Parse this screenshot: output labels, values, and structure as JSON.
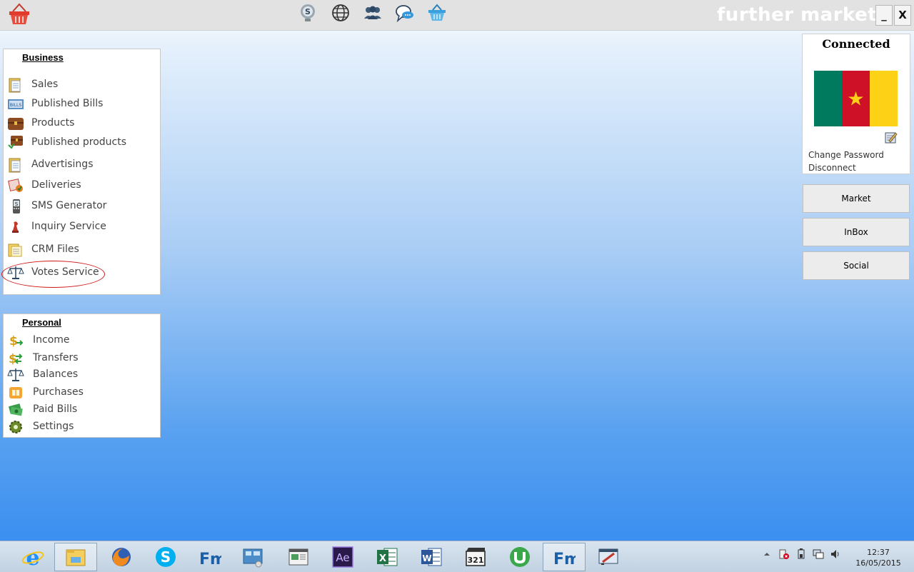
{
  "app": {
    "brand": "further market"
  },
  "window_controls": {
    "minimize": "_",
    "close": "X"
  },
  "top_icons": [
    "skype-bulb-icon",
    "globe-icon",
    "users-icon",
    "chat-icon",
    "basket-icon"
  ],
  "business": {
    "title": "Business",
    "items": [
      {
        "label": "Sales",
        "icon": "clipboard-icon"
      },
      {
        "label": "Published Bills",
        "icon": "bills-icon"
      },
      {
        "label": "Products",
        "icon": "chest-icon"
      },
      {
        "label": "Published products",
        "icon": "chest-publish-icon"
      },
      {
        "label": "Advertisings",
        "icon": "clipboard-icon"
      },
      {
        "label": "Deliveries",
        "icon": "delivery-icon"
      },
      {
        "label": "SMS Generator",
        "icon": "phone-icon"
      },
      {
        "label": "Inquiry Service",
        "icon": "chess-icon"
      },
      {
        "label": "CRM Files",
        "icon": "files-icon"
      },
      {
        "label": "Votes Service",
        "icon": "scales-icon"
      }
    ]
  },
  "personal": {
    "title": "Personal",
    "items": [
      {
        "label": "Income",
        "icon": "dollar-in-icon"
      },
      {
        "label": "Transfers",
        "icon": "dollar-transfer-icon"
      },
      {
        "label": "Balances",
        "icon": "scales-icon"
      },
      {
        "label": "Purchases",
        "icon": "cart-icon"
      },
      {
        "label": "Paid Bills",
        "icon": "money-icon"
      },
      {
        "label": "Settings",
        "icon": "gear-icon"
      }
    ]
  },
  "connection": {
    "status": "Connected",
    "flag": {
      "colors": [
        "#007a5e",
        "#ce1126",
        "#fcd116"
      ],
      "star": "#fcd116"
    },
    "change_password": "Change Password",
    "disconnect": "Disconnect"
  },
  "side_buttons": {
    "market": "Market",
    "inbox": "InBox",
    "social": "Social"
  },
  "taskbar": {
    "apps": [
      "internet-explorer-icon",
      "file-explorer-icon",
      "firefox-icon",
      "skype-icon",
      "fm-app-icon",
      "control-panel-icon",
      "window-app-icon",
      "after-effects-icon",
      "excel-icon",
      "word-icon",
      "media-player-icon",
      "utorrent-icon",
      "fm-app-icon",
      "paint-app-icon"
    ],
    "ae_label": "Ae",
    "fm_label": "Fm",
    "clock": {
      "time": "12:37",
      "date": "16/05/2015"
    }
  }
}
